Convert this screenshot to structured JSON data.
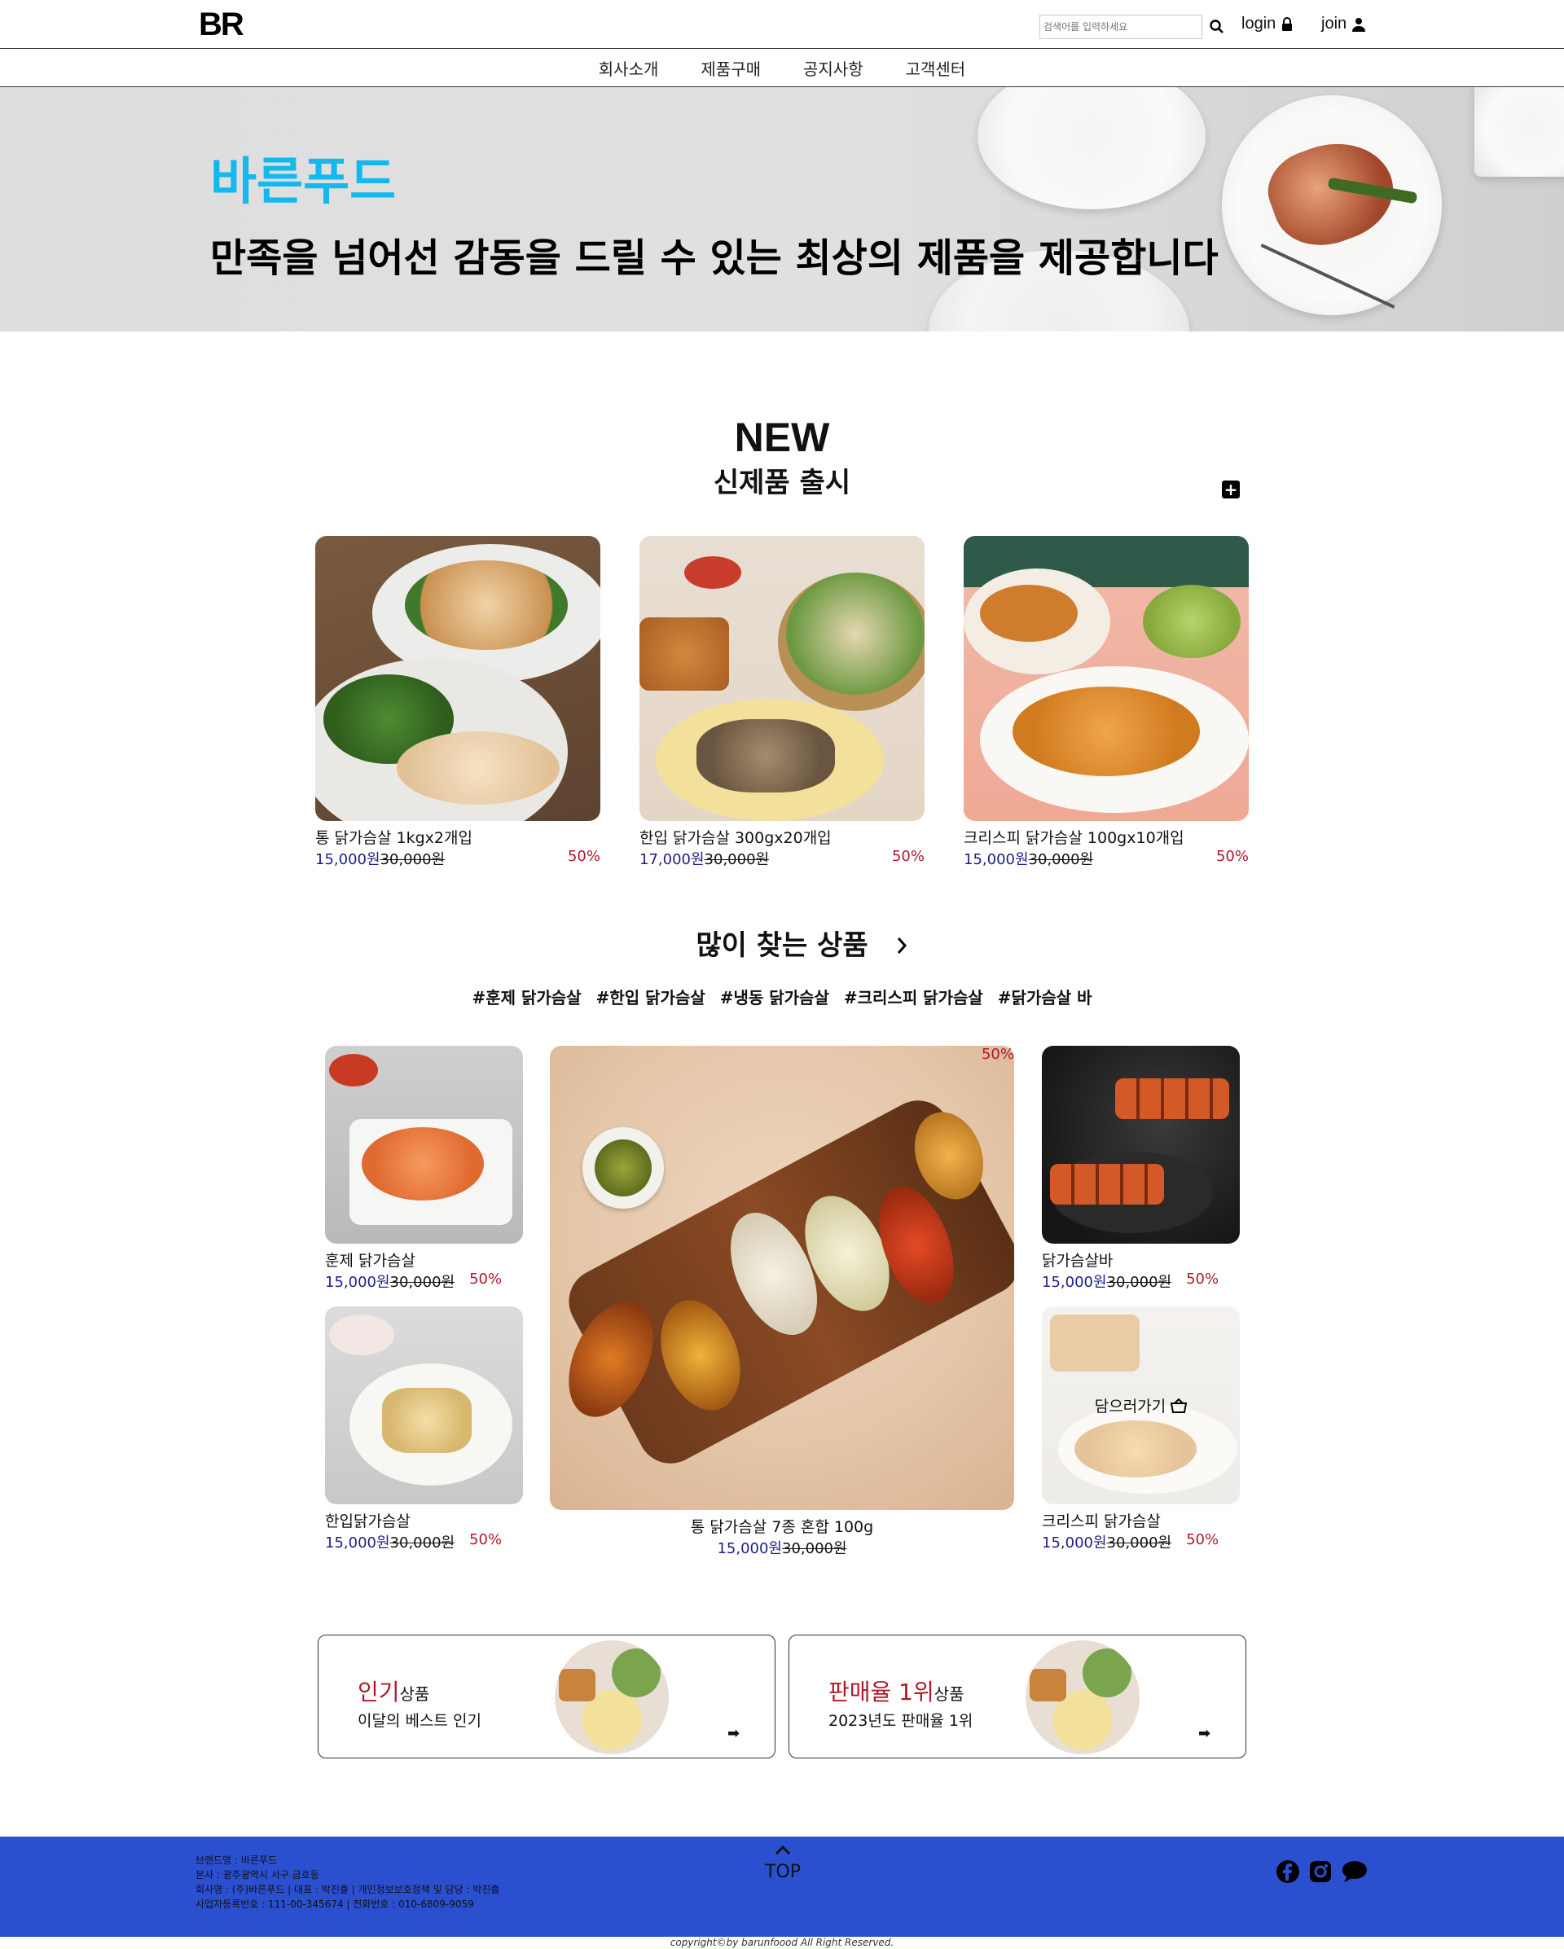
{
  "header": {
    "logo": "BR",
    "search_placeholder": "검색어를 입력하세요",
    "login_label": "login",
    "join_label": "join"
  },
  "nav": {
    "items": [
      "회사소개",
      "제품구매",
      "공지사항",
      "고객센터"
    ]
  },
  "hero": {
    "brand": "바른푸드",
    "tagline": "만족을 넘어선 감동을 드릴 수 있는 최상의 제품을 제공합니다"
  },
  "new_section": {
    "title": "NEW",
    "subtitle": "신제품 출시",
    "products": [
      {
        "name": "통 닭가슴살 1kgx2개입",
        "price": "15,000원",
        "old_price": "30,000원",
        "discount": "50%"
      },
      {
        "name": "한입 닭가슴살 300gx20개입",
        "price": "17,000원",
        "old_price": "30,000원",
        "discount": "50%"
      },
      {
        "name": "크리스피 닭가슴살 100gx10개입",
        "price": "15,000원",
        "old_price": "30,000원",
        "discount": "50%"
      }
    ]
  },
  "popular_section": {
    "title": "많이 찾는 상품",
    "tags": [
      "#훈제 닭가슴살",
      "#한입 닭가슴살",
      "#냉동 닭가슴살",
      "#크리스피 닭가슴살",
      "#닭가슴살 바"
    ],
    "products": [
      {
        "name": "훈제 닭가슴살",
        "price": "15,000원",
        "old_price": "30,000원",
        "discount": "50%"
      },
      {
        "name": "한입닭가슴살",
        "price": "15,000원",
        "old_price": "30,000원",
        "discount": "50%"
      },
      {
        "name": "통 닭가슴살 7종 혼합 100g",
        "price": "15,000원",
        "old_price": "30,000원",
        "discount": "50%"
      },
      {
        "name": "닭가슴살바",
        "price": "15,000원",
        "old_price": "30,000원",
        "discount": "50%"
      },
      {
        "name": "크리스피 닭가슴살",
        "price": "15,000원",
        "old_price": "30,000원",
        "discount": "50%"
      }
    ],
    "cart_label": "담으러가기"
  },
  "promos": [
    {
      "highlight": "인기",
      "suffix": "상품",
      "desc": "이달의 베스트 인기"
    },
    {
      "highlight": "판매율 1위",
      "suffix": "상품",
      "desc": "2023년도 판매율 1위"
    }
  ],
  "footer": {
    "lines": [
      "브랜드명 : 바른푸드",
      "본사 : 광주광역시 서구 금호동",
      "회사명 : (주)바른푸드 | 대표 : 박진출 | 개인정보보호정책 및 담당 : 박진출",
      "사업자등록번호 : 111-00-345674 | 전화번호 : 010-6809-9059"
    ],
    "top_label": "TOP",
    "copyright": "copyright©by barunfoood All Right Reserved."
  }
}
